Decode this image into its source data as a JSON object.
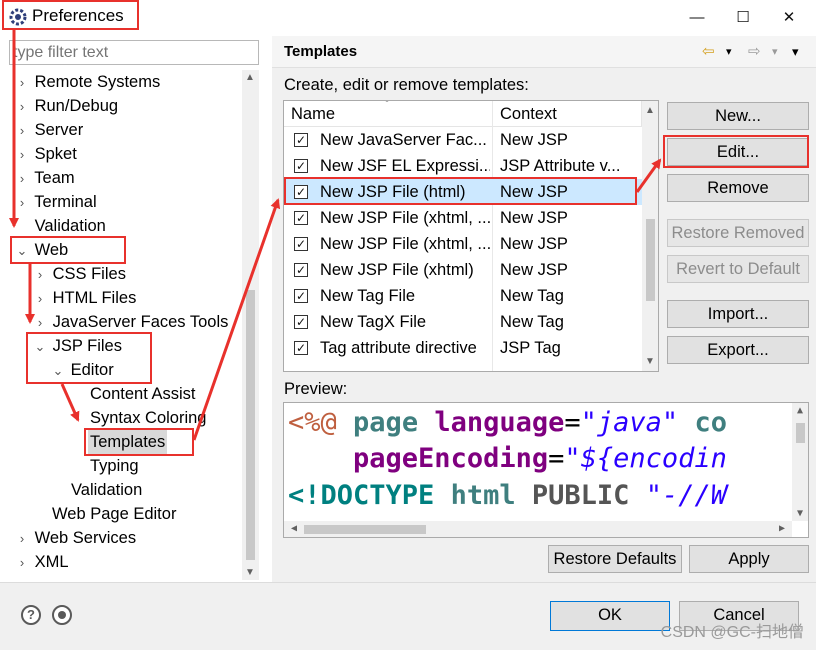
{
  "window": {
    "title": "Preferences",
    "minimize": "—",
    "maximize": "☐",
    "close": "✕"
  },
  "filter": {
    "placeholder": "type filter text"
  },
  "tree": [
    {
      "label": "Remote Systems",
      "toggle": "›"
    },
    {
      "label": "Run/Debug",
      "toggle": "›"
    },
    {
      "label": "Server",
      "toggle": "›"
    },
    {
      "label": "Spket",
      "toggle": "›"
    },
    {
      "label": "Team",
      "toggle": "›"
    },
    {
      "label": "Terminal",
      "toggle": "›"
    },
    {
      "label": "Validation",
      "toggle": ""
    },
    {
      "label": "Web",
      "toggle": "⌄"
    },
    {
      "label": "CSS Files",
      "toggle": "›"
    },
    {
      "label": "HTML Files",
      "toggle": "›"
    },
    {
      "label": "JavaServer Faces Tools",
      "toggle": "›"
    },
    {
      "label": "JSP Files",
      "toggle": "⌄"
    },
    {
      "label": "Editor",
      "toggle": "⌄"
    },
    {
      "label": "Content Assist",
      "toggle": ""
    },
    {
      "label": "Syntax Coloring",
      "toggle": ""
    },
    {
      "label": "Templates",
      "toggle": ""
    },
    {
      "label": "Typing",
      "toggle": ""
    },
    {
      "label": "Validation",
      "toggle": ""
    },
    {
      "label": "Web Page Editor",
      "toggle": ""
    },
    {
      "label": "Web Services",
      "toggle": "›"
    },
    {
      "label": "XML",
      "toggle": "›"
    }
  ],
  "page": {
    "title": "Templates",
    "back_icon": "⇦",
    "forward_icon": "⇨",
    "menu_arrow": "▾",
    "description": "Create, edit or remove templates:"
  },
  "table": {
    "columns": [
      "Name",
      "Context"
    ],
    "rows": [
      {
        "name": "New JavaServer Fac...",
        "context": "New JSP",
        "checked": true
      },
      {
        "name": "New JSF EL Expressi...",
        "context": "JSP Attribute v...",
        "checked": true
      },
      {
        "name": "New JSP File (html)",
        "context": "New JSP",
        "checked": true
      },
      {
        "name": "New JSP File (xhtml, ...",
        "context": "New JSP",
        "checked": true
      },
      {
        "name": "New JSP File (xhtml, ...",
        "context": "New JSP",
        "checked": true
      },
      {
        "name": "New JSP File (xhtml)",
        "context": "New JSP",
        "checked": true
      },
      {
        "name": "New Tag File",
        "context": "New Tag",
        "checked": true
      },
      {
        "name": "New TagX File",
        "context": "New Tag",
        "checked": true
      },
      {
        "name": "Tag attribute directive",
        "context": "JSP Tag",
        "checked": true
      }
    ],
    "check_mark": "✓"
  },
  "buttons": {
    "new": "New...",
    "edit": "Edit...",
    "remove": "Remove",
    "restore_removed": "Restore Removed",
    "revert_default": "Revert to Default",
    "import": "Import...",
    "export": "Export..."
  },
  "preview": {
    "label": "Preview:",
    "line1": {
      "tag": "<%@",
      "kw": "page",
      "attr": "language",
      "eq": "=",
      "str": "\"java\"",
      "rest": "co"
    },
    "line2": {
      "attr": "pageEncoding",
      "eq": "=",
      "str": "\"${encodin"
    },
    "line3": {
      "tag": "<!",
      "dt": "DOCTYPE",
      "sp": "html",
      "pub": "PUBLIC",
      "str": "\"-//W"
    }
  },
  "footer": {
    "restore_defaults": "Restore Defaults",
    "apply": "Apply",
    "ok": "OK",
    "cancel": "Cancel",
    "help_icon": "?",
    "watermark": "CSDN @GC-扫地僧"
  },
  "colors": {
    "annotation_red": "#e8312c",
    "selection_blue": "#cce8ff"
  }
}
